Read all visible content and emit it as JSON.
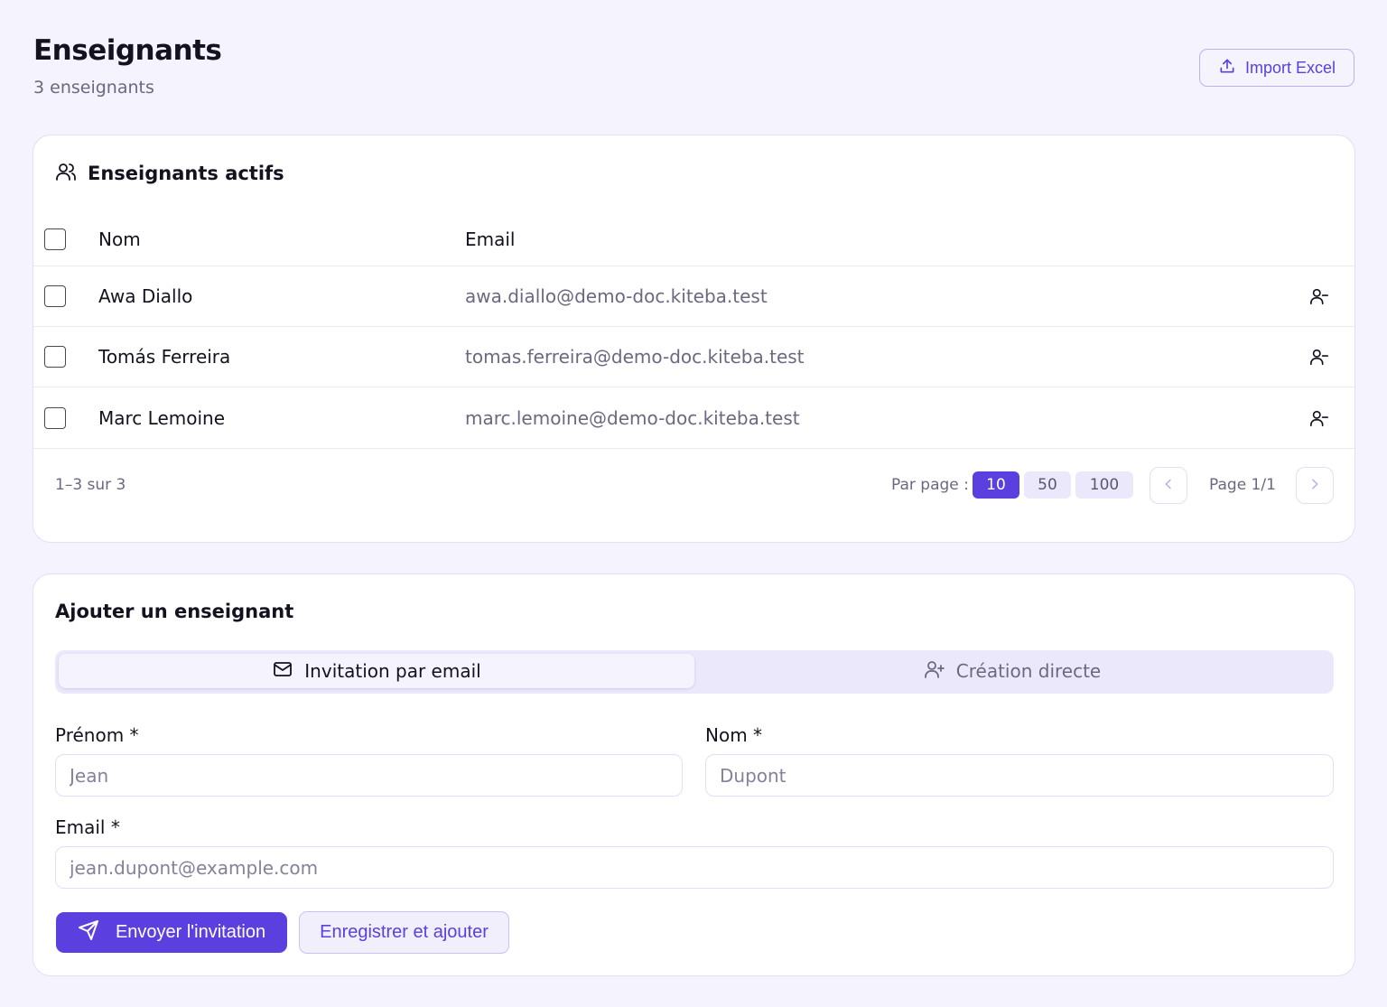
{
  "header": {
    "title": "Enseignants",
    "subtitle": "3 enseignants",
    "import_label": "Import Excel"
  },
  "active_card": {
    "title": "Enseignants actifs",
    "columns": {
      "name": "Nom",
      "email": "Email"
    },
    "rows": [
      {
        "name": "Awa Diallo",
        "email": "awa.diallo@demo-doc.kiteba.test"
      },
      {
        "name": "Tomás Ferreira",
        "email": "tomas.ferreira@demo-doc.kiteba.test"
      },
      {
        "name": "Marc Lemoine",
        "email": "marc.lemoine@demo-doc.kiteba.test"
      }
    ],
    "range_text": "1–3 sur 3",
    "per_page_label": "Par page :",
    "per_page_options": [
      "10",
      "50",
      "100"
    ],
    "per_page_selected": "10",
    "page_indicator": "Page 1/1"
  },
  "add_card": {
    "title": "Ajouter un enseignant",
    "tabs": {
      "email": "Invitation par email",
      "direct": "Création directe",
      "active": "email"
    },
    "fields": {
      "prenom_label": "Prénom *",
      "prenom_placeholder": "Jean",
      "nom_label": "Nom *",
      "nom_placeholder": "Dupont",
      "email_label": "Email *",
      "email_placeholder": "jean.dupont@example.com"
    },
    "send_label": "Envoyer l'invitation",
    "save_label": "Enregistrer et ajouter"
  },
  "colors": {
    "accent": "#5b3fdf",
    "background": "#f5f3fe",
    "border": "#e2defa"
  },
  "icons": {
    "import": "upload-icon",
    "card": "users-icon",
    "row_action": "user-minus-icon",
    "tab_email": "mail-icon",
    "tab_direct": "user-plus-icon",
    "send": "send-icon"
  }
}
